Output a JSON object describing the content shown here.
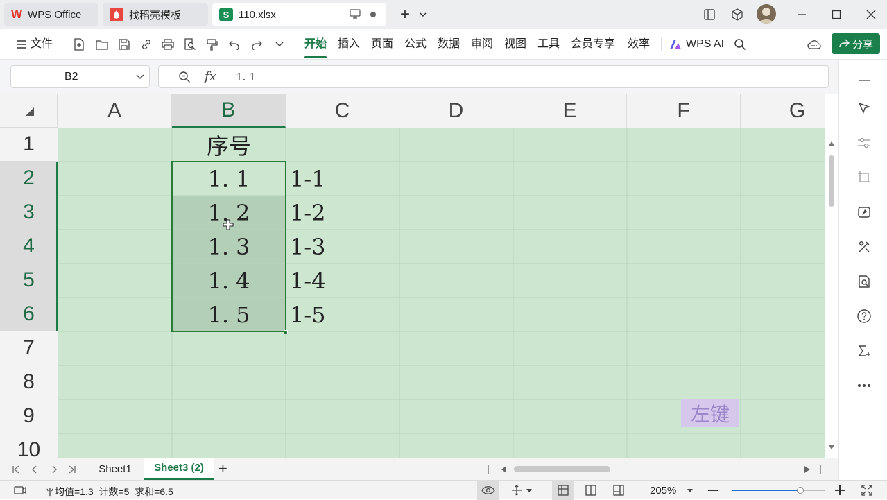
{
  "titlebar": {
    "tabs": [
      {
        "label": "WPS Office",
        "icon": "wps-logo-icon"
      },
      {
        "label": "找稻壳模板",
        "icon": "docer-icon"
      },
      {
        "label": "110.xlsx",
        "icon": "spreadsheet-s-icon",
        "icon_text": "S"
      }
    ],
    "new_tab": "+"
  },
  "menubar": {
    "file_label": "文件",
    "tabs": [
      "开始",
      "插入",
      "页面",
      "公式",
      "数据",
      "审阅",
      "视图",
      "工具",
      "会员专享",
      "效率"
    ],
    "active_tab": "开始",
    "wps_ai_label": "WPS AI",
    "share_label": "分享"
  },
  "formula_bar": {
    "cell_ref": "B2",
    "fx_label": "fx",
    "formula_value": "1. 1"
  },
  "grid": {
    "columns": [
      "A",
      "B",
      "C",
      "D",
      "E",
      "F",
      "G"
    ],
    "selected_column": "B",
    "rows": [
      "1",
      "2",
      "3",
      "4",
      "5",
      "6",
      "7",
      "8",
      "9",
      "10"
    ],
    "selected_rows": [
      "2",
      "3",
      "4",
      "5",
      "6"
    ],
    "cells": {
      "B1": "序号",
      "B2": "1. 1",
      "B3": "1. 2",
      "B4": "1. 3",
      "B5": "1. 4",
      "B6": "1. 5",
      "C2": "1-1",
      "C3": "1-2",
      "C4": "1-3",
      "C5": "1-4",
      "C6": "1-5"
    },
    "selection": "B2:B6",
    "overlay_label": "左键"
  },
  "sheets": {
    "tabs": [
      "Sheet1",
      "Sheet3 (2)"
    ],
    "active": "Sheet3 (2)",
    "add": "+"
  },
  "statusbar": {
    "summary": "平均值=1.3  计数=5  求和=6.5",
    "zoom": "205%",
    "zoom_fraction": 0.74
  },
  "colors": {
    "accent": "#1f7a4a",
    "cell_bg": "#cce6d0",
    "selection_bg": "#b4cfb7",
    "share_bg": "#1a7f4b"
  }
}
